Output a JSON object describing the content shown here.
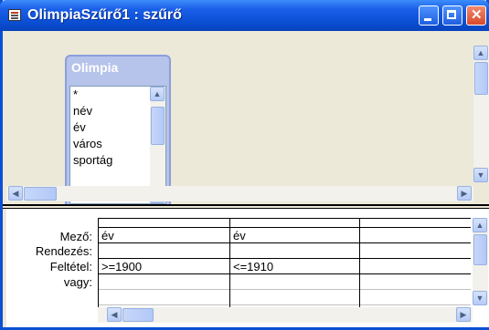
{
  "window": {
    "title": "OlimpiaSzűrő1 : szűrő"
  },
  "table": {
    "name": "Olimpia",
    "fields": [
      "*",
      "név",
      "év",
      "város",
      "sportág"
    ]
  },
  "grid": {
    "row_labels": [
      "Mező:",
      "Rendezés:",
      "Feltétel:",
      "vagy:"
    ],
    "columns": [
      {
        "field": "év",
        "sort": "",
        "criteria": ">=1900",
        "or": ""
      },
      {
        "field": "év",
        "sort": "",
        "criteria": "<=1910",
        "or": ""
      },
      {
        "field": "",
        "sort": "",
        "criteria": "",
        "or": ""
      }
    ]
  },
  "icons": {
    "app": "query-icon",
    "minimize": "minimize-icon",
    "maximize": "maximize-icon",
    "close": "close-icon"
  }
}
